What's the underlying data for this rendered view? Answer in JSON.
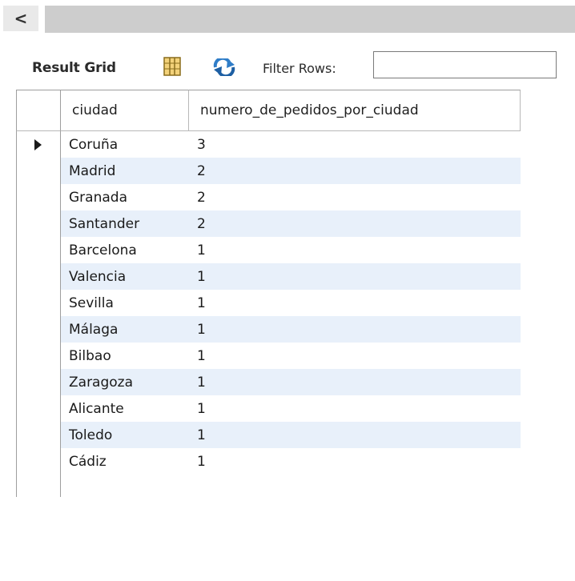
{
  "top_bar": {
    "collapse_label": "<"
  },
  "toolbar": {
    "result_grid_label": "Result Grid",
    "grid_icon": "grid-layout-icon",
    "refresh_icon": "refresh-icon",
    "filter_label": "Filter Rows:",
    "filter_value": ""
  },
  "grid": {
    "columns": [
      "ciudad",
      "numero_de_pedidos_por_ciudad"
    ],
    "selected_row_index": 0,
    "rows": [
      {
        "ciudad": "Coruña",
        "count": "3"
      },
      {
        "ciudad": "Madrid",
        "count": "2"
      },
      {
        "ciudad": "Granada",
        "count": "2"
      },
      {
        "ciudad": "Santander",
        "count": "2"
      },
      {
        "ciudad": "Barcelona",
        "count": "1"
      },
      {
        "ciudad": "Valencia",
        "count": "1"
      },
      {
        "ciudad": "Sevilla",
        "count": "1"
      },
      {
        "ciudad": "Málaga",
        "count": "1"
      },
      {
        "ciudad": "Bilbao",
        "count": "1"
      },
      {
        "ciudad": "Zaragoza",
        "count": "1"
      },
      {
        "ciudad": "Alicante",
        "count": "1"
      },
      {
        "ciudad": "Toledo",
        "count": "1"
      },
      {
        "ciudad": "Cádiz",
        "count": "1"
      }
    ],
    "alt_row_color": "#e8f0fa"
  }
}
